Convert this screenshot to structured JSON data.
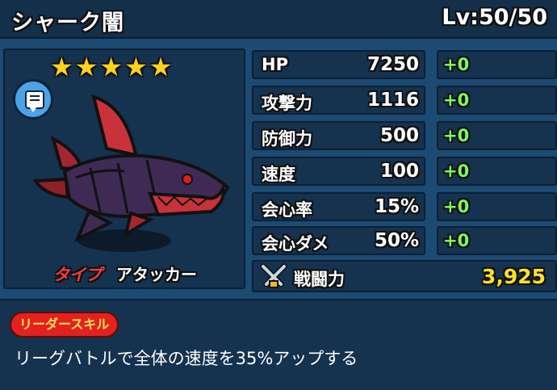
{
  "header": {
    "name": "シャーク闇",
    "level": "Lv:50/50"
  },
  "character": {
    "stars": 5,
    "type_label": "タイプ",
    "type_value": "アタッカー",
    "chat_icon": "speech-bubble-icon"
  },
  "stats": [
    {
      "label": "HP",
      "value": "7250",
      "bonus": "+0"
    },
    {
      "label": "攻撃力",
      "value": "1116",
      "bonus": "+0"
    },
    {
      "label": "防御力",
      "value": "500",
      "bonus": "+0"
    },
    {
      "label": "速度",
      "value": "100",
      "bonus": "+0"
    },
    {
      "label": "会心率",
      "value": "15%",
      "bonus": "+0"
    },
    {
      "label": "会心ダメ",
      "value": "50%",
      "bonus": "+0"
    }
  ],
  "power": {
    "label": "戦闘力",
    "value": "3,925",
    "icon": "crossed-swords-icon"
  },
  "leader_skill": {
    "tag": "リーダースキル",
    "description": "リーグバトルで全体の速度を35%アップする"
  },
  "colors": {
    "bonus": "#7dff5a",
    "power": "#ffe02a",
    "star": "#ffd21f",
    "tag": "#e3221f"
  }
}
